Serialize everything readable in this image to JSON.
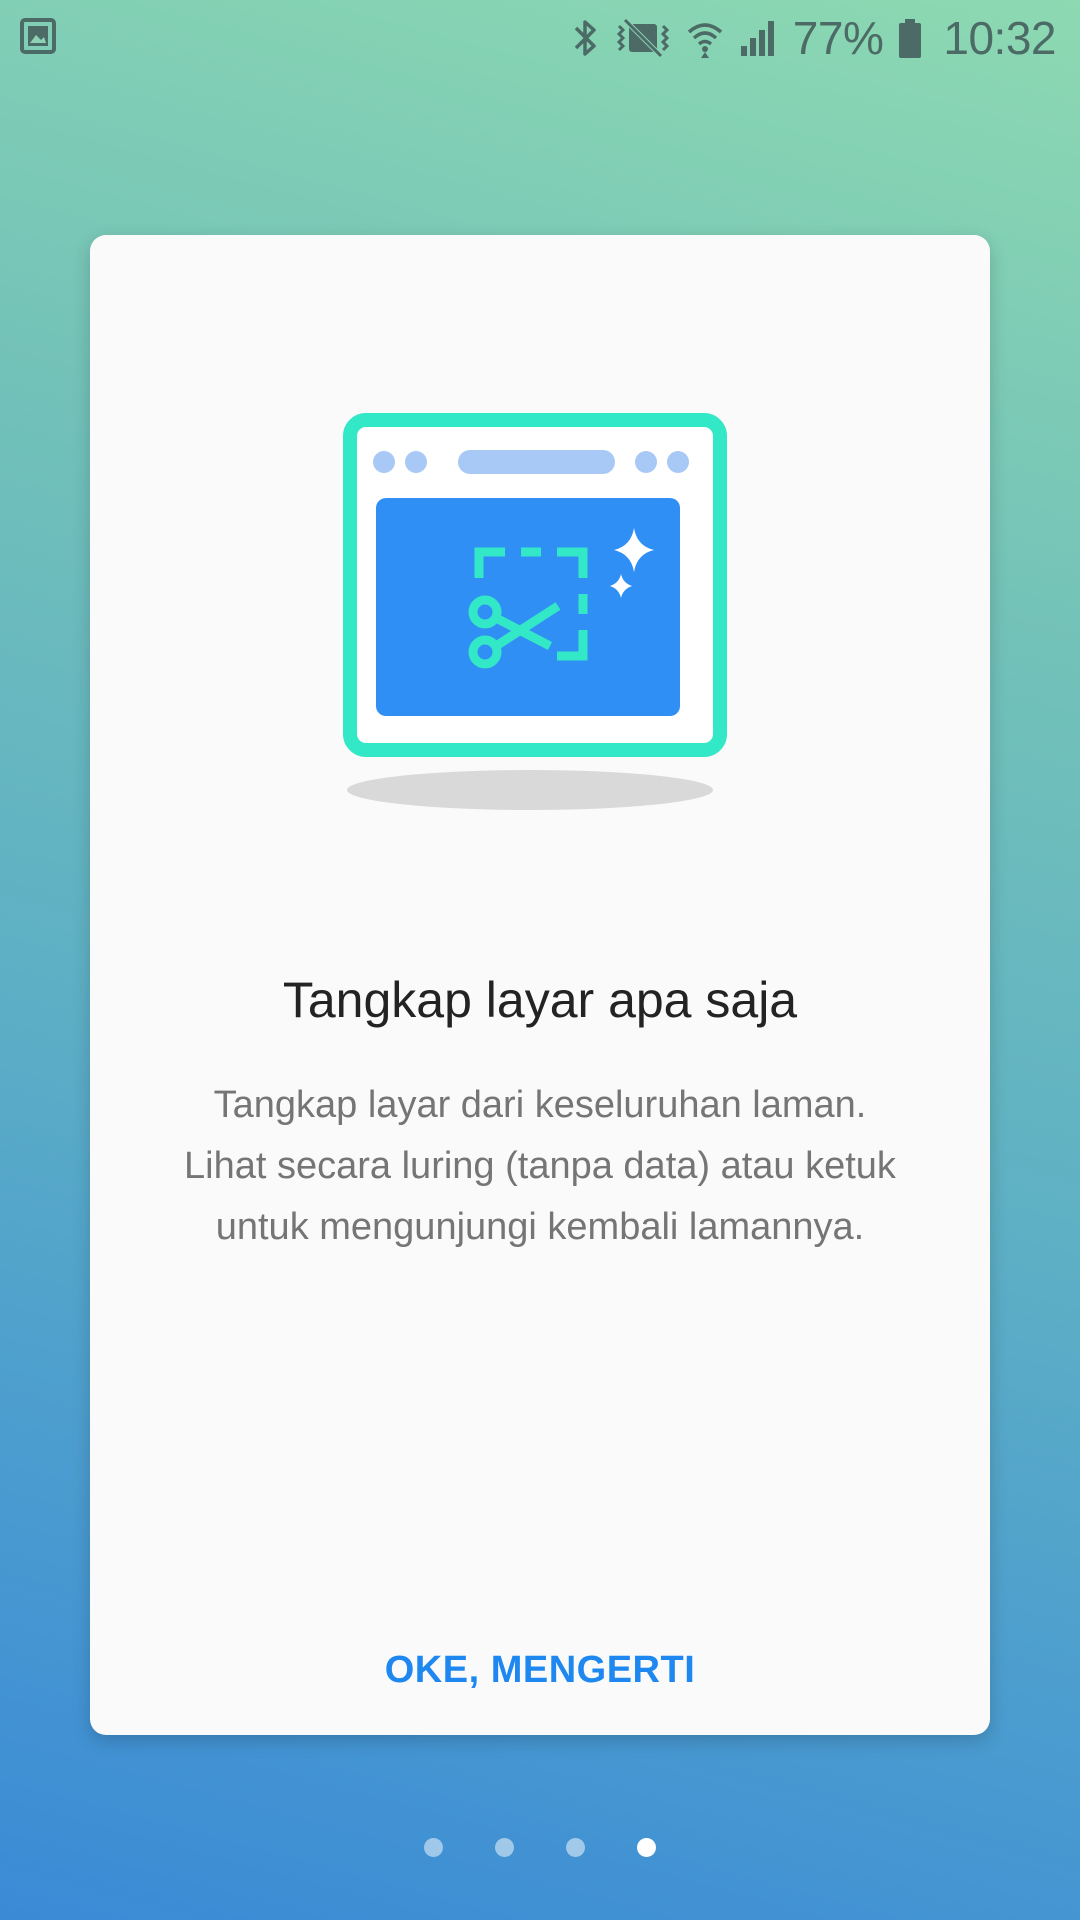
{
  "status_bar": {
    "icons": [
      "image-icon",
      "bluetooth-icon",
      "vibrate-mute-icon",
      "wifi-icon",
      "signal-icon",
      "battery-icon"
    ],
    "battery_percent": "77%",
    "time": "10:32"
  },
  "card": {
    "illustration_icons": [
      "browser-window-icon",
      "screenshot-crop-icon",
      "scissors-icon",
      "sparkle-icon"
    ],
    "title": "Tangkap layar apa saja",
    "body": "Tangkap layar dari keseluruhan laman. Lihat secara luring (tanpa data) atau ketuk untuk mengunjungi kembali lamannya.",
    "ok_label": "OKE, MENGERTI"
  },
  "pager": {
    "total_pages": 4,
    "current_page": 4
  },
  "colors": {
    "accent": "#1e88f0",
    "illustration_teal": "#33e8c6",
    "illustration_blue": "#308ff5",
    "illustration_light_blue": "#a8c9f5"
  }
}
